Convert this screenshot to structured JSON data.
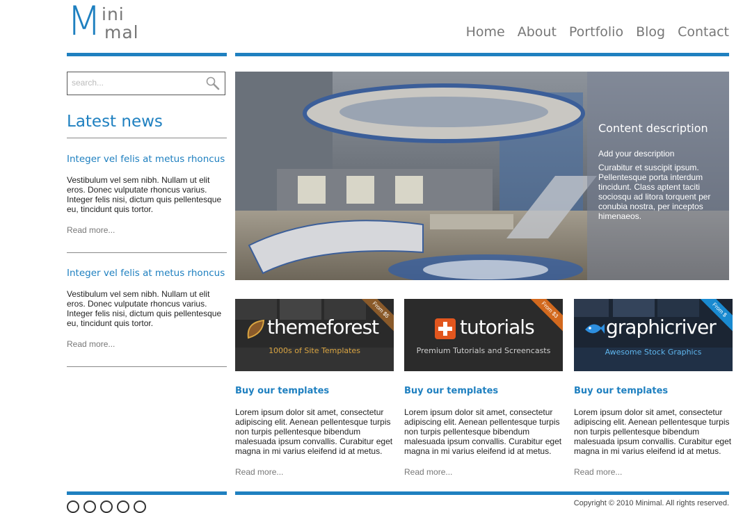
{
  "brand": {
    "letter": "M",
    "line1": "ini",
    "line2": "mal"
  },
  "nav": [
    "Home",
    "About",
    "Portfolio",
    "Blog",
    "Contact"
  ],
  "search": {
    "placeholder": "search..."
  },
  "sidebar": {
    "heading": "Latest news",
    "posts": [
      {
        "title": "Integer vel felis at metus rhoncus",
        "text": "Vestibulum vel sem nibh. Nullam ut elit eros. Donec vulputate rhoncus varius. Integer felis nisi, dictum quis pellentesque eu, tincidunt quis tortor.",
        "more": "Read more..."
      },
      {
        "title": "Integer vel felis at metus rhoncus",
        "text": "Vestibulum vel sem nibh. Nullam ut elit eros. Donec vulputate rhoncus varius. Integer felis nisi, dictum quis pellentesque eu, tincidunt quis tortor.",
        "more": "Read more..."
      }
    ]
  },
  "hero": {
    "heading": "Content description",
    "subheading": "Add your description",
    "text": "Curabitur et suscipit ipsum. Pellentesque porta interdum tincidunt. Class aptent taciti sociosqu ad litora torquent per conubia nostra, per inceptos himenaeos."
  },
  "products": [
    {
      "brand": "themeforest",
      "tagline": "1000s of Site Templates",
      "ribbon": "From $5",
      "title": "Buy our templates",
      "text": "Lorem ipsum dolor sit amet, consectetur adipiscing elit. Aenean pellentesque turpis non turpis pellentesque bibendum malesuada ipsum convallis. Curabitur eget magna in mi varius eleifend id at metus.",
      "more": "Read more...",
      "colors": {
        "bg": "#2a2a2a",
        "tag": "#d9a441",
        "ribbon": "#8a5a2a"
      }
    },
    {
      "brand": "tutorials",
      "tagline": "Premium Tutorials and Screencasts",
      "ribbon": "From $3",
      "title": "Buy our templates",
      "text": "Lorem ipsum dolor sit amet, consectetur adipiscing elit. Aenean pellentesque turpis non turpis pellentesque bibendum malesuada ipsum convallis. Curabitur eget magna in mi varius eleifend id at metus.",
      "more": "Read more...",
      "colors": {
        "bg": "#2b2b2b",
        "tag": "#cfcfcf",
        "ribbon": "#d2691e"
      }
    },
    {
      "brand": "graphicriver",
      "tagline": "Awesome Stock Graphics",
      "ribbon": "From $",
      "title": "Buy our templates",
      "text": "Lorem ipsum dolor sit amet, consectetur adipiscing elit. Aenean pellentesque turpis non turpis pellentesque bibendum malesuada ipsum convallis. Curabitur eget magna in mi varius eleifend id at metus.",
      "more": "Read more...",
      "colors": {
        "bg": "#1b2533",
        "tag": "#5fb6ee",
        "ribbon": "#1a8ad0"
      }
    }
  ],
  "footer": {
    "copyright": "Copyright © 2010 Minimal. All rights reserved."
  },
  "colors": {
    "accent": "#1f80c0",
    "muted": "#777777"
  }
}
